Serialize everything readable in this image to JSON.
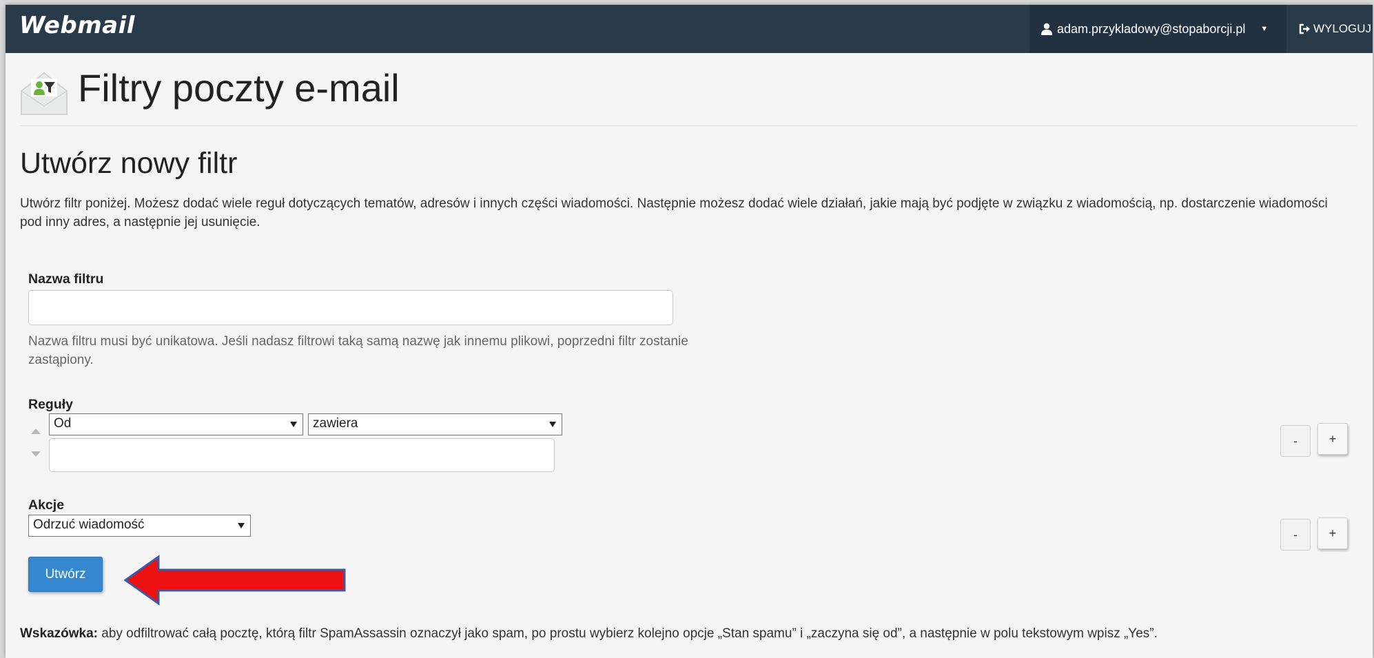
{
  "topbar": {
    "brand": "Webmail",
    "user_email": "adam.przykladowy@stopaborcji.pl",
    "logout_label": "WYLOGUJ",
    "icons": {
      "user": "user-icon",
      "caret": "caret-down-icon",
      "logout": "sign-out-icon"
    }
  },
  "page": {
    "title": "Filtry poczty e-mail",
    "icon": "mail-filter-icon"
  },
  "form": {
    "section_title": "Utwórz nowy filtr",
    "intro": "Utwórz filtr poniżej. Możesz dodać wiele reguł dotyczących tematów, adresów i innych części wiadomości. Następnie możesz dodać wiele działań, jakie mają być podjęte w związku z wiadomością, np. dostarczenie wiadomości pod inny adres, a następnie jej usunięcie.",
    "filter_name": {
      "label": "Nazwa filtru",
      "value": "",
      "help": "Nazwa filtru musi być unikatowa. Jeśli nadasz filtrowi taką samą nazwę jak innemu plikowi, poprzedni filtr zostanie zastąpiony."
    },
    "rules": {
      "label": "Reguły",
      "field_select": "Od",
      "operator_select": "zawiera",
      "value": "",
      "remove_label": "-",
      "add_label": "+"
    },
    "actions": {
      "label": "Akcje",
      "action_select": "Odrzuć wiadomość",
      "remove_label": "-",
      "add_label": "+"
    },
    "submit_label": "Utwórz"
  },
  "hint": {
    "prefix": "Wskazówka:",
    "text": " aby odfiltrować całą pocztę, którą filtr SpamAssassin oznaczył jako spam, po prostu wybierz kolejno opcje „Stan spamu” i „zaczyna się od”, a następnie w polu tekstowym wpisz „Yes”."
  },
  "colors": {
    "navbar": "#293a4a",
    "user_menu_bg": "#223141",
    "primary_button": "#3588cf",
    "annotation_arrow": "#ee1111",
    "annotation_arrow_outline": "#3a5aa8"
  }
}
